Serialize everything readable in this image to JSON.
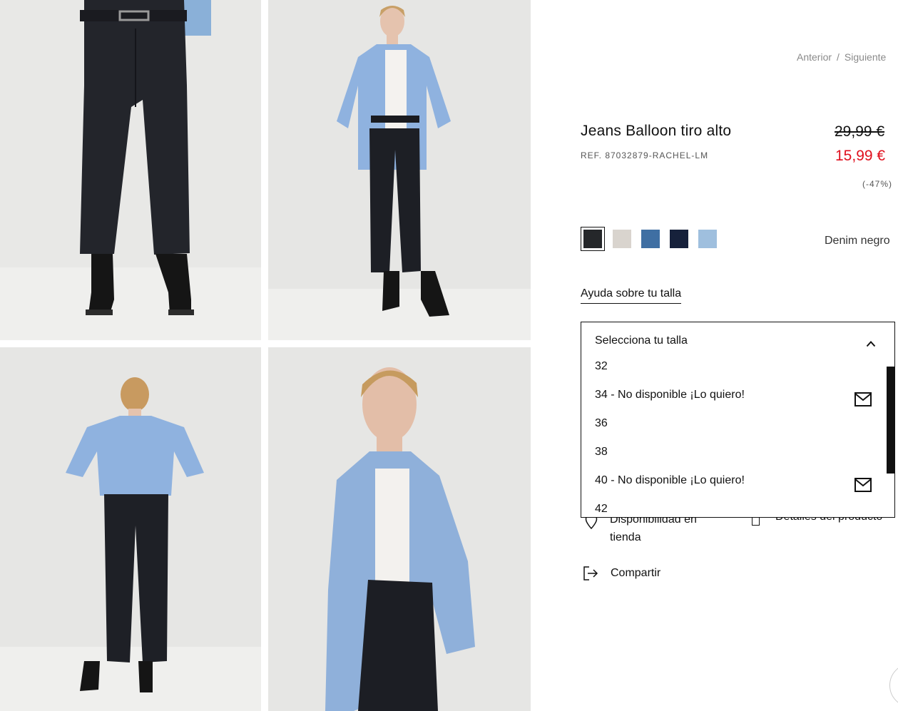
{
  "gallery": {
    "photos": [
      {
        "name": "jeans-closeup"
      },
      {
        "name": "full-body-front"
      },
      {
        "name": "full-body-back"
      },
      {
        "name": "portrait-shirt"
      }
    ]
  },
  "pager": {
    "previous": "Anterior",
    "separator": "/",
    "next": "Siguiente"
  },
  "product": {
    "title": "Jeans Balloon tiro alto",
    "ref": "REF. 87032879-RACHEL-LM",
    "price_old": "29,99 €",
    "price_new": "15,99 €",
    "discount": "(-47%)",
    "price_new_color": "#e00f1d"
  },
  "colors": {
    "selected_name": "Denim negro",
    "swatches": [
      {
        "name": "denim-negro",
        "color": "#25272a",
        "selected": true
      },
      {
        "name": "beige",
        "color": "#d9d4ce",
        "selected": false
      },
      {
        "name": "medium-blue",
        "color": "#3f6fa3",
        "selected": false
      },
      {
        "name": "navy",
        "color": "#16213b",
        "selected": false
      },
      {
        "name": "light-blue",
        "color": "#9fbfde",
        "selected": false
      }
    ]
  },
  "size_help": {
    "label": "Ayuda sobre tu talla"
  },
  "size_dropdown": {
    "placeholder": "Selecciona tu talla",
    "options": [
      {
        "label": "32",
        "unavailable": false
      },
      {
        "label": "34 - No disponible ¡Lo quiero!",
        "unavailable": true
      },
      {
        "label": "36",
        "unavailable": false
      },
      {
        "label": "38",
        "unavailable": false
      },
      {
        "label": "40 - No disponible ¡Lo quiero!",
        "unavailable": true
      },
      {
        "label": "42",
        "unavailable": false
      }
    ]
  },
  "extras": {
    "store_availability": "Disponibilidad en tienda",
    "product_details": "Detalles del producto",
    "share": "Compartir"
  },
  "icons": {
    "chevron": "chevron-up-icon",
    "mail": "mail-icon",
    "share": "share-icon",
    "pin": "location-pin-icon"
  }
}
